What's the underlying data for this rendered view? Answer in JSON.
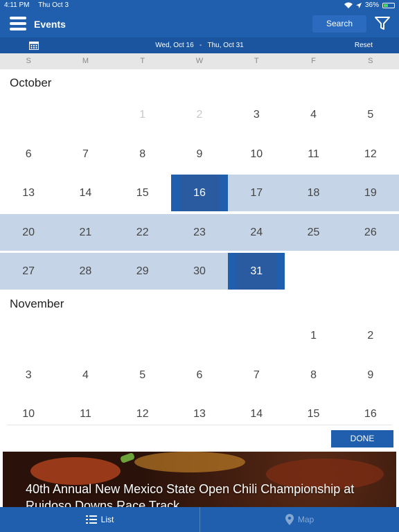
{
  "status": {
    "time": "4:11 PM",
    "date": "Thu Oct 3",
    "battery": "36%"
  },
  "header": {
    "title": "Events",
    "search_label": "Search"
  },
  "range": {
    "start": "Wed, Oct 16",
    "separator": "-",
    "end": "Thu, Oct 31",
    "reset_label": "Reset"
  },
  "weekdays": [
    "S",
    "M",
    "T",
    "W",
    "T",
    "F",
    "S"
  ],
  "months": [
    {
      "name": "October",
      "weeks": [
        [
          "",
          "",
          "1",
          "2",
          "3",
          "4",
          "5"
        ],
        [
          "6",
          "7",
          "8",
          "9",
          "10",
          "11",
          "12"
        ],
        [
          "13",
          "14",
          "15",
          "16",
          "17",
          "18",
          "19"
        ],
        [
          "20",
          "21",
          "22",
          "23",
          "24",
          "25",
          "26"
        ],
        [
          "27",
          "28",
          "29",
          "30",
          "31",
          "",
          ""
        ]
      ]
    },
    {
      "name": "November",
      "weeks": [
        [
          "",
          "",
          "",
          "",
          "",
          "1",
          "2"
        ],
        [
          "3",
          "4",
          "5",
          "6",
          "7",
          "8",
          "9"
        ],
        [
          "10",
          "11",
          "12",
          "13",
          "14",
          "15",
          "16"
        ]
      ]
    }
  ],
  "done_label": "DONE",
  "event_card": {
    "title": "40th Annual New Mexico State Open Chili Championship at Ruidoso Downs Race Track"
  },
  "tabs": {
    "list_label": "List",
    "map_label": "Map"
  },
  "colors": {
    "primary": "#1f5fad",
    "range_fill": "#c5d4e6",
    "selected": "#2a5aa0"
  }
}
